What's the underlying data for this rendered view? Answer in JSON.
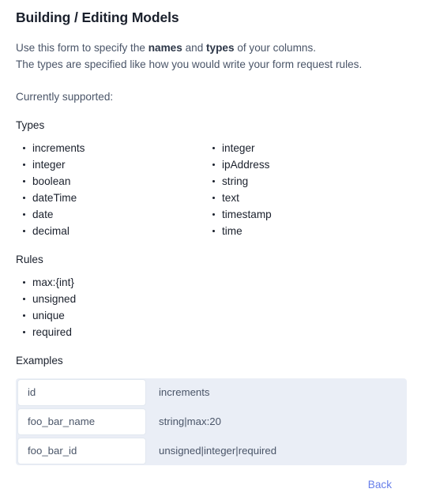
{
  "page": {
    "title": "Building / Editing Models"
  },
  "intro": {
    "line1_part1": "Use this form to specify the ",
    "line1_strong1": "names",
    "line1_part2": " and ",
    "line1_strong2": "types",
    "line1_part3": " of your columns.",
    "line2": "The types are specified like how you would write your form request rules.",
    "supported_label": "Currently supported:"
  },
  "types": {
    "heading": "Types",
    "column1": [
      "increments",
      "integer",
      "boolean",
      "dateTime",
      "date",
      "decimal"
    ],
    "column2": [
      "integer",
      "ipAddress",
      "string",
      "text",
      "timestamp",
      "time"
    ]
  },
  "rules": {
    "heading": "Rules",
    "items": [
      "max:{int}",
      "unsigned",
      "unique",
      "required"
    ]
  },
  "examples": {
    "heading": "Examples",
    "rows": [
      {
        "name": "id",
        "type": "increments"
      },
      {
        "name": "foo_bar_name",
        "type": "string|max:20"
      },
      {
        "name": "foo_bar_id",
        "type": "unsigned|integer|required"
      }
    ]
  },
  "footer": {
    "back_label": "Back"
  },
  "colors": {
    "heading": "#1a202c",
    "body_text": "#4a5568",
    "panel_bg": "#eaeef6",
    "input_bg": "#ffffff",
    "input_border": "#e2e8f0",
    "link": "#667eea",
    "page_bg": "#ffffff"
  }
}
